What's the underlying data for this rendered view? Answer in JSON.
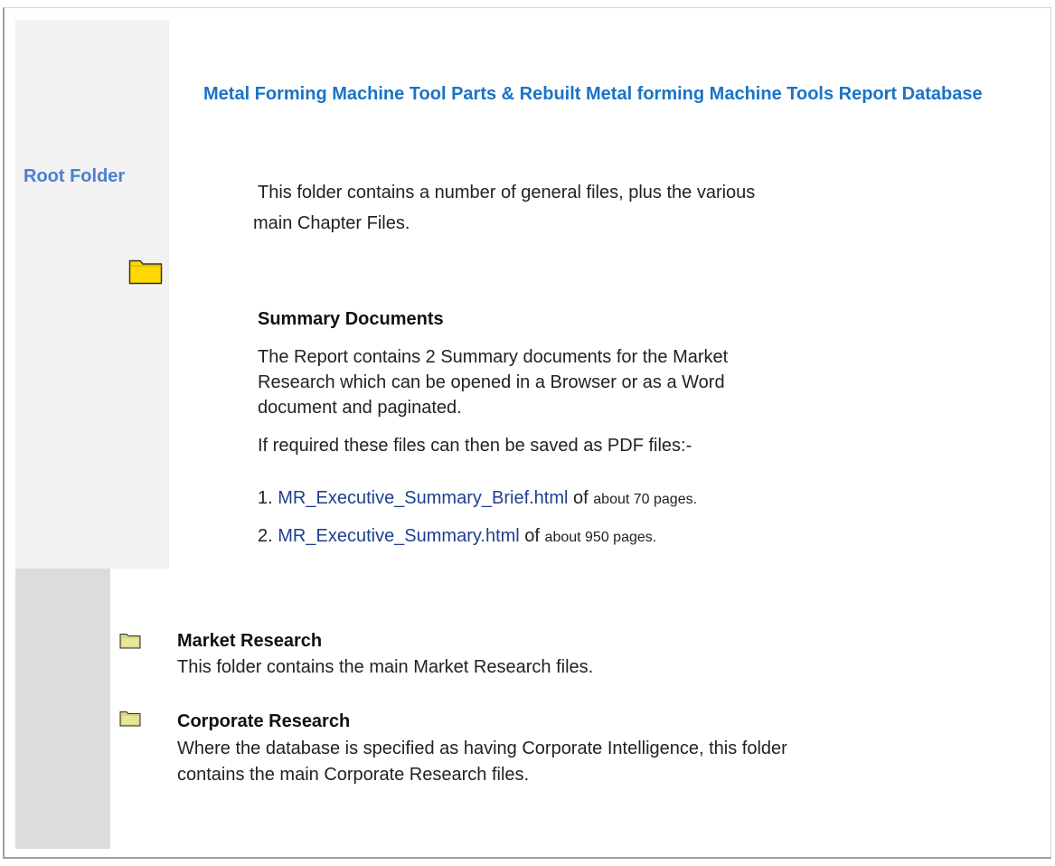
{
  "header": {
    "title": "Metal Forming Machine Tool Parts & Rebuilt Metal forming Machine Tools Report Database"
  },
  "sidebar": {
    "label": "Root Folder",
    "folder_icon": "folder-icon"
  },
  "intro": {
    "line1": "This folder contains a number of general files, plus the various",
    "line2": "main Chapter Files."
  },
  "summary": {
    "heading": "Summary Documents",
    "para1_line1": "The Report contains 2 Summary documents for the Market",
    "para1_line2": "Research which can be opened in a Browser or as a Word",
    "para1_line3": "document and paginated.",
    "para2": "If required these files can then be saved as PDF files:-",
    "items": [
      {
        "num": "1.",
        "link": "MR_Executive_Summary_Brief.html",
        "of": "of",
        "pages": "about 70 pages."
      },
      {
        "num": "2.",
        "link": "MR_Executive_Summary.html",
        "of": "of",
        "pages": "about 950 pages."
      }
    ]
  },
  "folders": [
    {
      "name": "Market Research",
      "desc_line1": "This folder contains the main Market Research files."
    },
    {
      "name": "Corporate Research",
      "desc_line1": "Where the database is specified as having Corporate Intelligence, this folder",
      "desc_line2": "contains the main Corporate Research files."
    }
  ],
  "colors": {
    "title": "#1a73c6",
    "root_label": "#4a7fd0",
    "link": "#1f3f8f",
    "folder_yellow": "#ffd800"
  }
}
